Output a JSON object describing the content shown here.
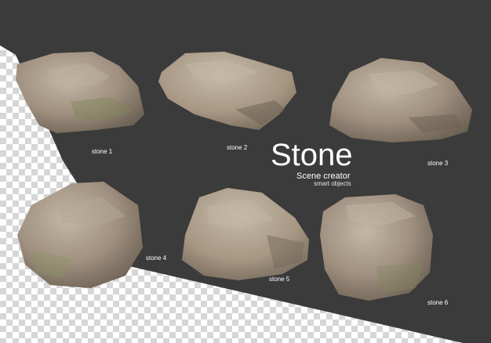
{
  "title": "Stone",
  "subtitle": "Scene creator",
  "tagline": "smart objects",
  "labels": {
    "stone1": "stone 1",
    "stone2": "stone 2",
    "stone3": "stone 3",
    "stone4": "stone 4",
    "stone5": "stone 5",
    "stone6": "stone 6"
  },
  "colors": {
    "panel": "#3b3b3b",
    "checker_light": "#ffffff",
    "checker_dark": "#d6d6d6",
    "rock_base": "#a89682",
    "rock_light": "#d0c4b2",
    "rock_shadow": "#5e5142",
    "moss": "#8c9a5e"
  }
}
